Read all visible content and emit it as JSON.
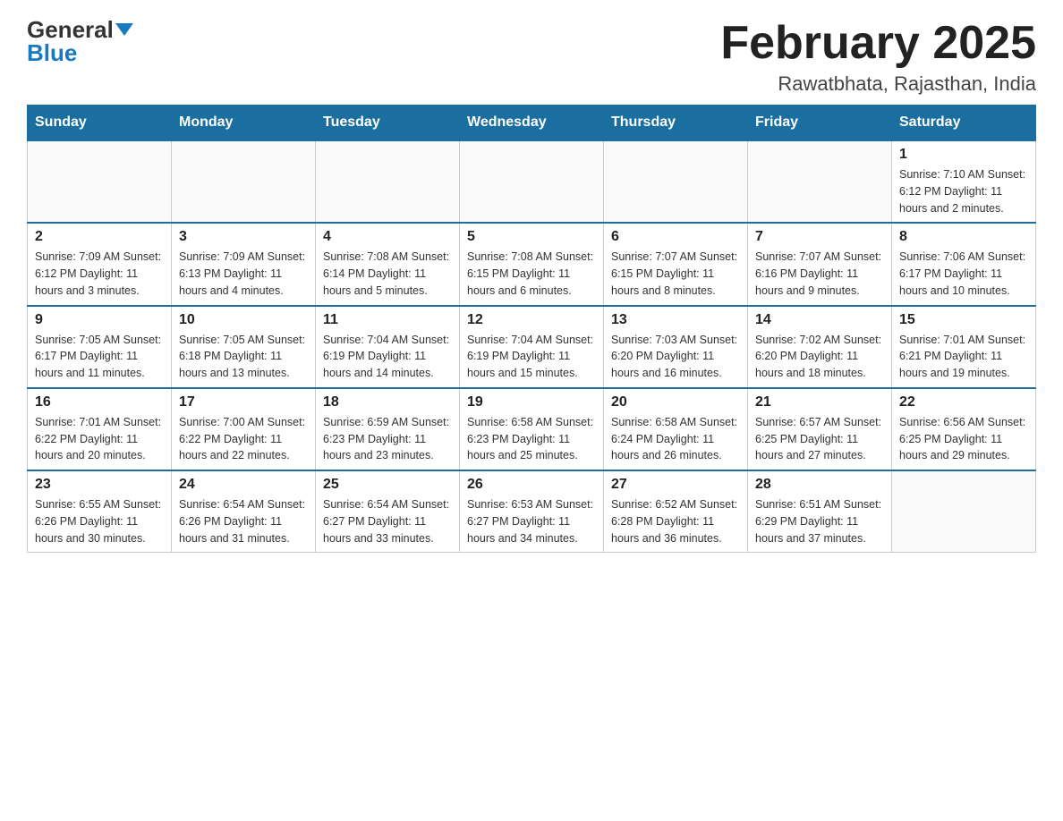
{
  "header": {
    "logo_general": "General",
    "logo_blue": "Blue",
    "month_title": "February 2025",
    "location": "Rawatbhata, Rajasthan, India"
  },
  "days_of_week": [
    "Sunday",
    "Monday",
    "Tuesday",
    "Wednesday",
    "Thursday",
    "Friday",
    "Saturday"
  ],
  "weeks": [
    [
      {
        "day": "",
        "info": ""
      },
      {
        "day": "",
        "info": ""
      },
      {
        "day": "",
        "info": ""
      },
      {
        "day": "",
        "info": ""
      },
      {
        "day": "",
        "info": ""
      },
      {
        "day": "",
        "info": ""
      },
      {
        "day": "1",
        "info": "Sunrise: 7:10 AM\nSunset: 6:12 PM\nDaylight: 11 hours and 2 minutes."
      }
    ],
    [
      {
        "day": "2",
        "info": "Sunrise: 7:09 AM\nSunset: 6:12 PM\nDaylight: 11 hours and 3 minutes."
      },
      {
        "day": "3",
        "info": "Sunrise: 7:09 AM\nSunset: 6:13 PM\nDaylight: 11 hours and 4 minutes."
      },
      {
        "day": "4",
        "info": "Sunrise: 7:08 AM\nSunset: 6:14 PM\nDaylight: 11 hours and 5 minutes."
      },
      {
        "day": "5",
        "info": "Sunrise: 7:08 AM\nSunset: 6:15 PM\nDaylight: 11 hours and 6 minutes."
      },
      {
        "day": "6",
        "info": "Sunrise: 7:07 AM\nSunset: 6:15 PM\nDaylight: 11 hours and 8 minutes."
      },
      {
        "day": "7",
        "info": "Sunrise: 7:07 AM\nSunset: 6:16 PM\nDaylight: 11 hours and 9 minutes."
      },
      {
        "day": "8",
        "info": "Sunrise: 7:06 AM\nSunset: 6:17 PM\nDaylight: 11 hours and 10 minutes."
      }
    ],
    [
      {
        "day": "9",
        "info": "Sunrise: 7:05 AM\nSunset: 6:17 PM\nDaylight: 11 hours and 11 minutes."
      },
      {
        "day": "10",
        "info": "Sunrise: 7:05 AM\nSunset: 6:18 PM\nDaylight: 11 hours and 13 minutes."
      },
      {
        "day": "11",
        "info": "Sunrise: 7:04 AM\nSunset: 6:19 PM\nDaylight: 11 hours and 14 minutes."
      },
      {
        "day": "12",
        "info": "Sunrise: 7:04 AM\nSunset: 6:19 PM\nDaylight: 11 hours and 15 minutes."
      },
      {
        "day": "13",
        "info": "Sunrise: 7:03 AM\nSunset: 6:20 PM\nDaylight: 11 hours and 16 minutes."
      },
      {
        "day": "14",
        "info": "Sunrise: 7:02 AM\nSunset: 6:20 PM\nDaylight: 11 hours and 18 minutes."
      },
      {
        "day": "15",
        "info": "Sunrise: 7:01 AM\nSunset: 6:21 PM\nDaylight: 11 hours and 19 minutes."
      }
    ],
    [
      {
        "day": "16",
        "info": "Sunrise: 7:01 AM\nSunset: 6:22 PM\nDaylight: 11 hours and 20 minutes."
      },
      {
        "day": "17",
        "info": "Sunrise: 7:00 AM\nSunset: 6:22 PM\nDaylight: 11 hours and 22 minutes."
      },
      {
        "day": "18",
        "info": "Sunrise: 6:59 AM\nSunset: 6:23 PM\nDaylight: 11 hours and 23 minutes."
      },
      {
        "day": "19",
        "info": "Sunrise: 6:58 AM\nSunset: 6:23 PM\nDaylight: 11 hours and 25 minutes."
      },
      {
        "day": "20",
        "info": "Sunrise: 6:58 AM\nSunset: 6:24 PM\nDaylight: 11 hours and 26 minutes."
      },
      {
        "day": "21",
        "info": "Sunrise: 6:57 AM\nSunset: 6:25 PM\nDaylight: 11 hours and 27 minutes."
      },
      {
        "day": "22",
        "info": "Sunrise: 6:56 AM\nSunset: 6:25 PM\nDaylight: 11 hours and 29 minutes."
      }
    ],
    [
      {
        "day": "23",
        "info": "Sunrise: 6:55 AM\nSunset: 6:26 PM\nDaylight: 11 hours and 30 minutes."
      },
      {
        "day": "24",
        "info": "Sunrise: 6:54 AM\nSunset: 6:26 PM\nDaylight: 11 hours and 31 minutes."
      },
      {
        "day": "25",
        "info": "Sunrise: 6:54 AM\nSunset: 6:27 PM\nDaylight: 11 hours and 33 minutes."
      },
      {
        "day": "26",
        "info": "Sunrise: 6:53 AM\nSunset: 6:27 PM\nDaylight: 11 hours and 34 minutes."
      },
      {
        "day": "27",
        "info": "Sunrise: 6:52 AM\nSunset: 6:28 PM\nDaylight: 11 hours and 36 minutes."
      },
      {
        "day": "28",
        "info": "Sunrise: 6:51 AM\nSunset: 6:29 PM\nDaylight: 11 hours and 37 minutes."
      },
      {
        "day": "",
        "info": ""
      }
    ]
  ]
}
